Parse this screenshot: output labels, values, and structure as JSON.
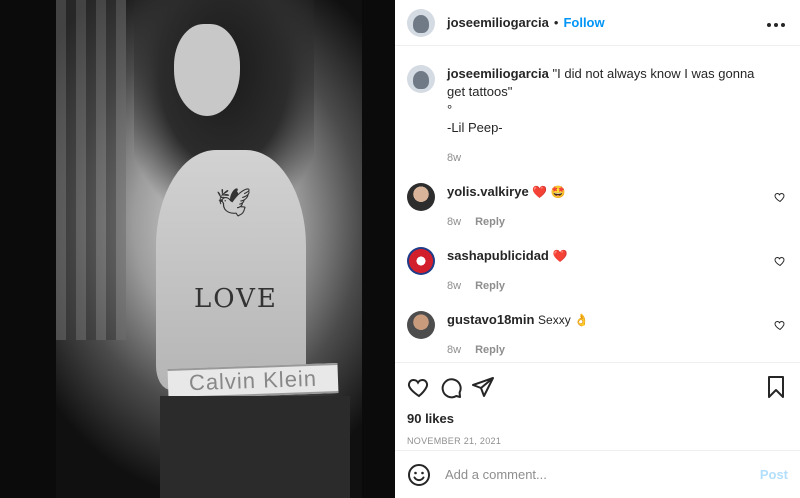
{
  "header": {
    "username": "joseemiliogarcia",
    "separator": "•",
    "follow_label": "Follow",
    "more_icon": "more-horizontal-icon"
  },
  "image": {
    "waistband_text": "Calvin Klein",
    "tattoo_text": "LOVE"
  },
  "caption": {
    "username": "joseemiliogarcia",
    "text": "\"I did not always know I was gonna get tattoos\"",
    "symbol": "°",
    "attribution": "-Lil Peep-",
    "time": "8w"
  },
  "comments": [
    {
      "username": "yolis.valkirye",
      "text": "❤️ 🤩",
      "time": "8w",
      "reply_label": "Reply"
    },
    {
      "username": "sashapublicidad",
      "text": "❤️",
      "time": "8w",
      "reply_label": "Reply"
    },
    {
      "username": "gustavo18min",
      "text": "Sexxy 👌",
      "time": "8w",
      "reply_label": "Reply"
    }
  ],
  "actions": {
    "likes": "90 likes",
    "date": "November 21, 2021"
  },
  "add_comment": {
    "placeholder": "Add a comment...",
    "post_label": "Post"
  },
  "colors": {
    "accent": "#0095f6",
    "post_disabled": "#b2dffc",
    "muted": "#8e8e8e",
    "text": "#262626"
  }
}
